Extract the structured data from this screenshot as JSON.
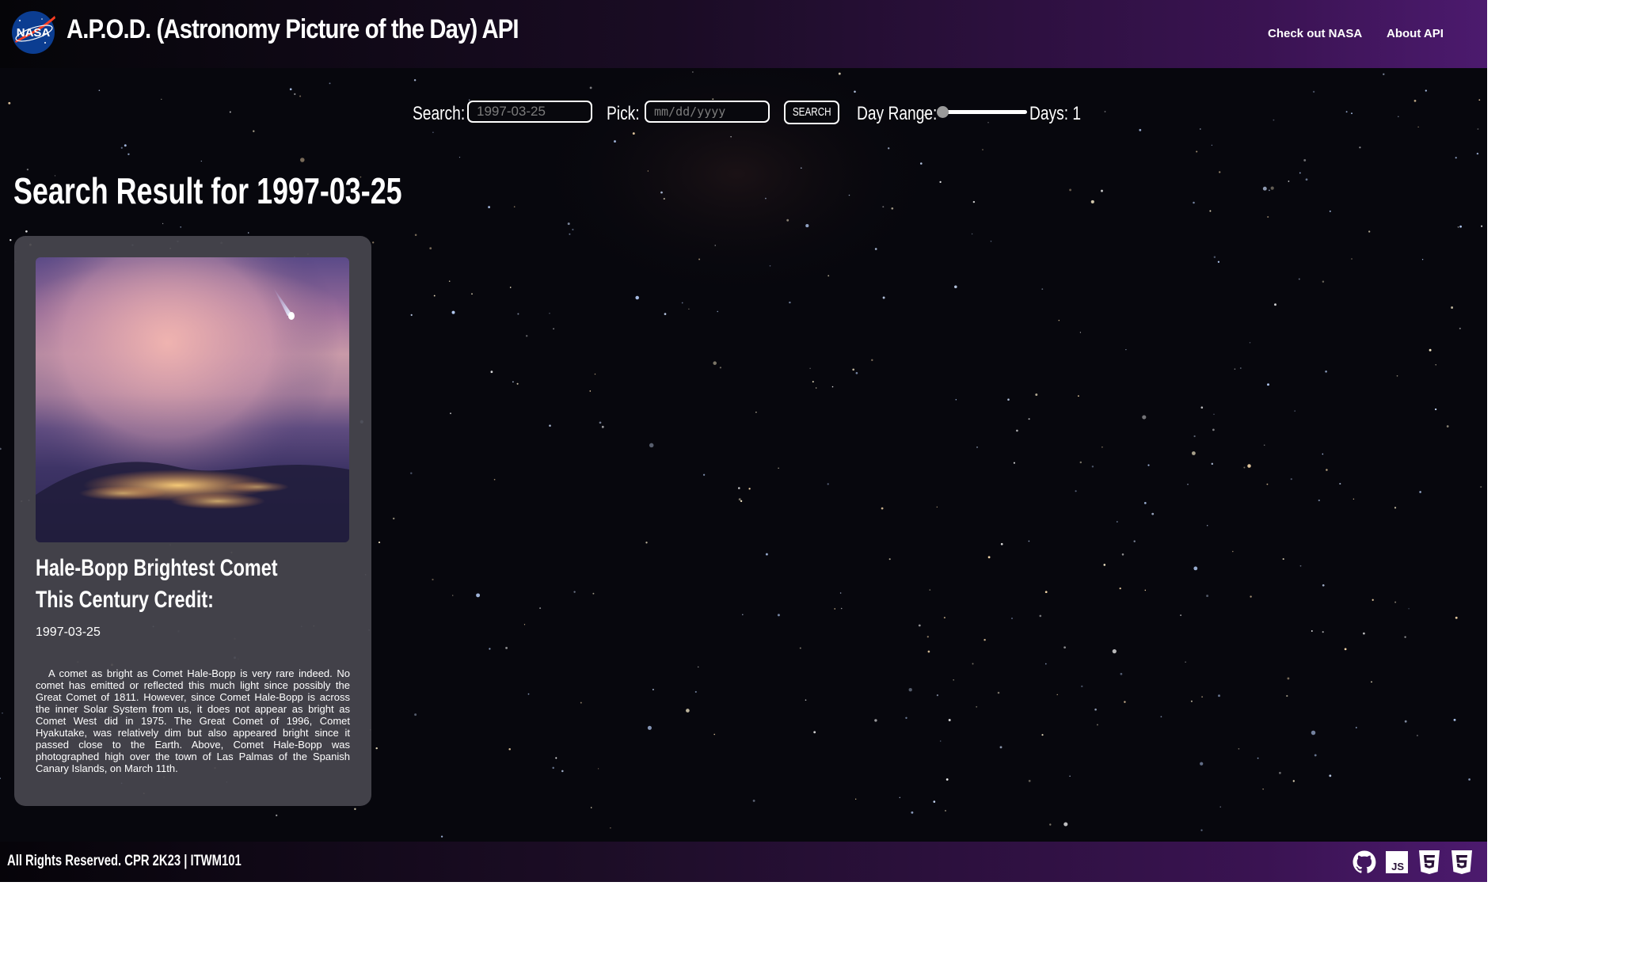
{
  "header": {
    "title": "A.P.O.D. (Astronomy Picture of the Day) API",
    "logo_text": "NASA",
    "nav": [
      {
        "label": "Check out NASA"
      },
      {
        "label": "About API"
      }
    ]
  },
  "search_bar": {
    "search_label": "Search:",
    "search_input": {
      "value": "",
      "placeholder": "1997-03-25"
    },
    "pick_label": "Pick:",
    "pick_input": {
      "value": "",
      "placeholder": "mm/dd/yyyy"
    },
    "search_button": "SEARCH",
    "range_label": "Day Range:",
    "range_value": 1,
    "range_fill_fraction": 0.0,
    "days_label": "Days: 1"
  },
  "results": {
    "heading": "Search Result for 1997-03-25",
    "cards": [
      {
        "title": "Hale-Bopp Brightest Comet This Century Credit:",
        "date": "1997-03-25",
        "description": "A comet as bright as Comet Hale-Bopp is very rare indeed. No comet has emitted or reflected this much light since possibly the Great Comet of 1811. However, since Comet Hale-Bopp is across the inner Solar System from us, it does not appear as bright as Comet West did in 1975. The Great Comet of 1996, Comet Hyakutake, was relatively dim but also appeared bright since it passed close to the Earth. Above, Comet Hale-Bopp was photographed high over the town of Las Palmas of the Spanish Canary Islands, on March 11th."
      }
    ]
  },
  "footer": {
    "text": "All Rights Reserved. CPR 2K23 | ITWM101",
    "icons": [
      "github-icon",
      "javascript-icon",
      "html5-icon",
      "css3-icon"
    ],
    "js_badge_text": "JS"
  },
  "colors": {
    "background": "#07070d",
    "header_gradient_end": "#4c1a6e",
    "card_background": "#48464e",
    "text": "#ffffff",
    "placeholder": "#7c7c7c"
  }
}
